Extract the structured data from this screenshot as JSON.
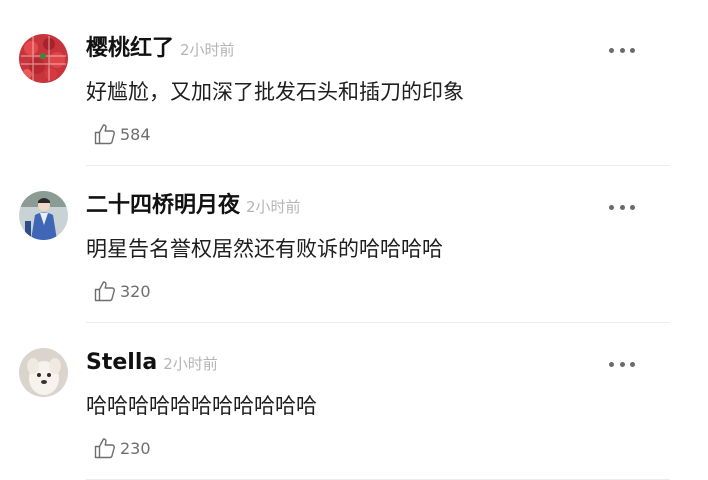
{
  "comments": [
    {
      "username": "樱桃红了",
      "time": "2小时前",
      "text": "好尴尬，又加深了批发石头和插刀的印象",
      "likes": "584",
      "avatar_icon": "strawberry-avatar",
      "avatar_color": "#c8343b"
    },
    {
      "username": "二十四桥明月夜",
      "time": "2小时前",
      "text": "明星告名誉权居然还有败诉的哈哈哈哈",
      "likes": "320",
      "avatar_icon": "costume-figure-avatar",
      "avatar_color": "#3f67b5"
    },
    {
      "username": "Stella",
      "time": "2小时前",
      "text": "哈哈哈哈哈哈哈哈哈哈哈",
      "likes": "230",
      "avatar_icon": "white-dog-avatar",
      "avatar_color": "#d9d4cc"
    }
  ],
  "more_icon": "more-dots-icon",
  "like_icon": "thumbs-up-icon"
}
